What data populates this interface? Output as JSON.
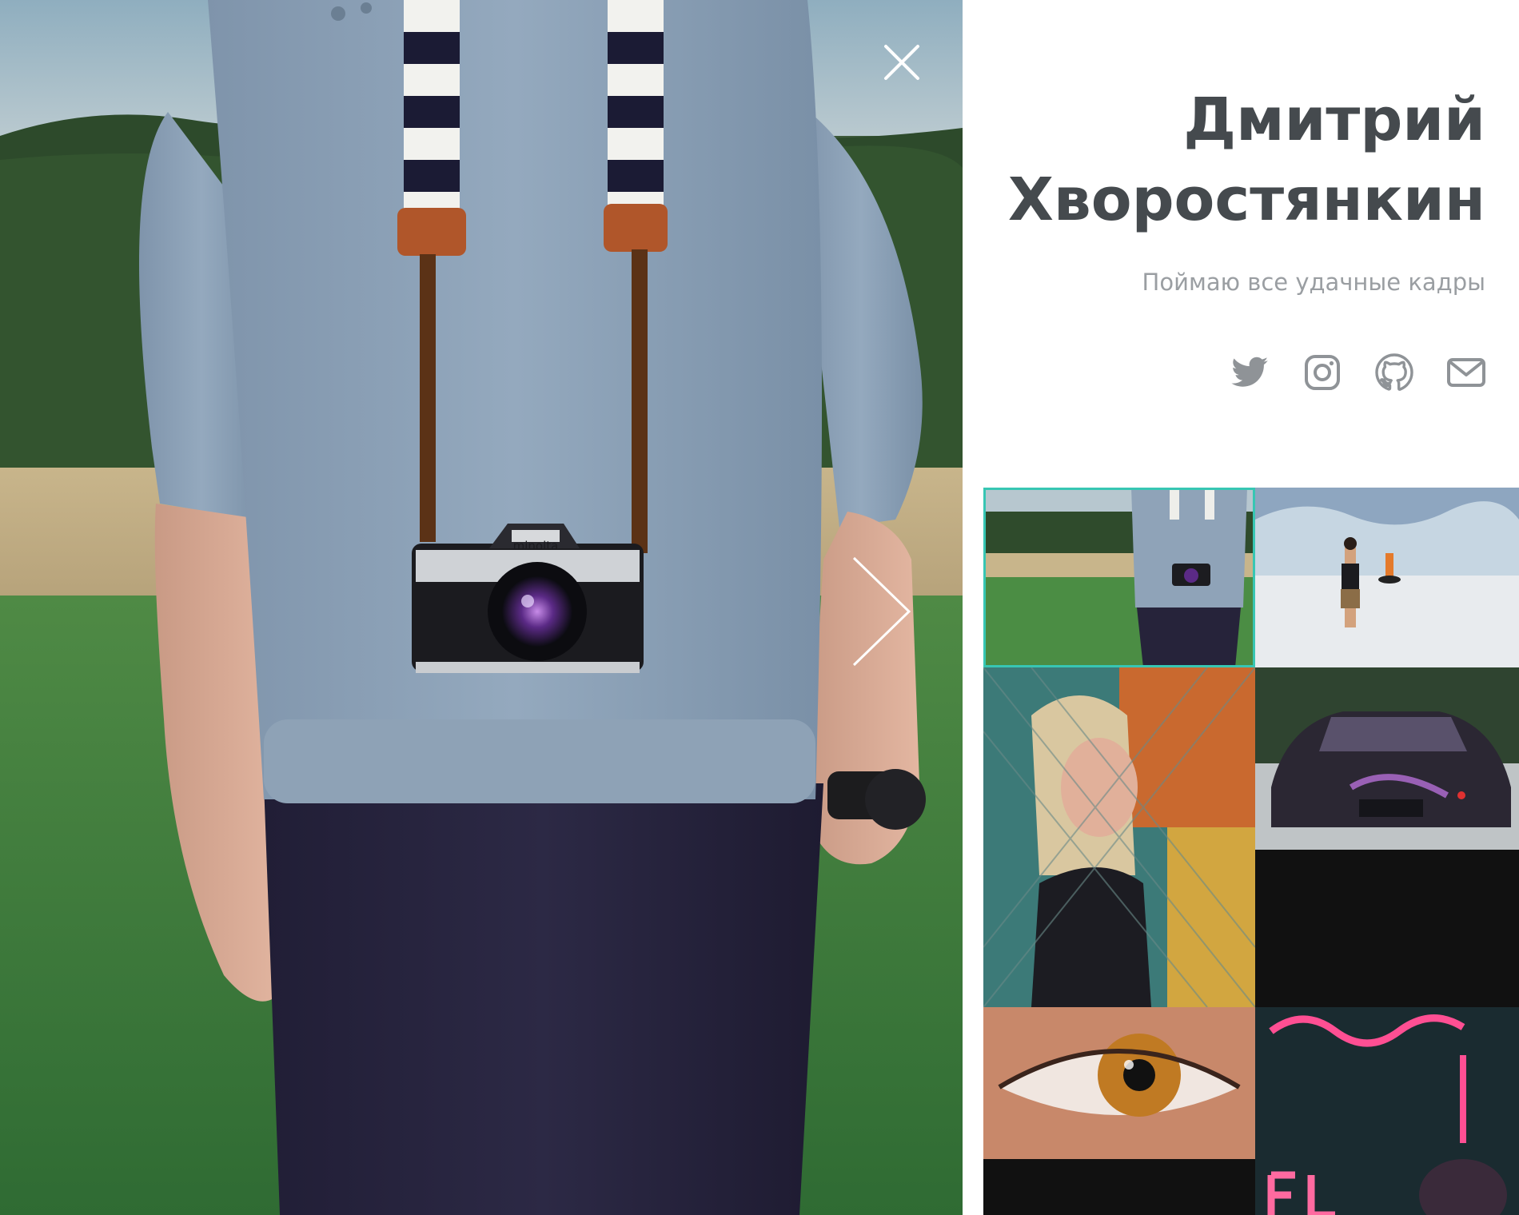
{
  "profile": {
    "name_line1": "Дмитрий",
    "name_line2": "Хворостянкин",
    "tagline": "Поймаю все удачные кадры"
  },
  "social": [
    {
      "icon": "twitter-icon"
    },
    {
      "icon": "instagram-icon"
    },
    {
      "icon": "github-icon"
    },
    {
      "icon": "mail-icon"
    }
  ],
  "viewer": {
    "camera_brand": "minolta",
    "close_icon": "close-icon",
    "next_icon": "chevron-right-icon"
  },
  "gallery": {
    "active_index": 0,
    "accent": "#37c6b3",
    "items": [
      {
        "subject": "photographer-with-camera"
      },
      {
        "subject": "woman-on-salt-flat"
      },
      {
        "subject": "girl-behind-net"
      },
      {
        "subject": "black-sports-car"
      },
      {
        "subject": "amber-eye"
      },
      {
        "subject": "neon-sign"
      }
    ]
  },
  "colors": {
    "title": "#454a4e",
    "tagline": "#9a9ea2",
    "icons": "#8f9397",
    "active_border": "#37c6b3"
  }
}
